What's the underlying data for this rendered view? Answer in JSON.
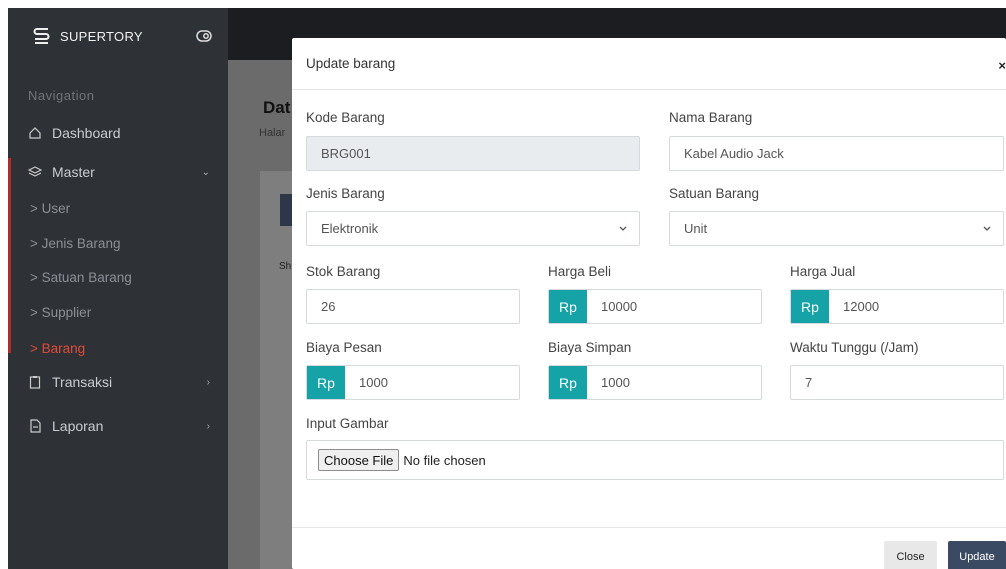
{
  "sidebar": {
    "brand": "SUPERTORY",
    "nav_title": "Navigation",
    "dashboard": "Dashboard",
    "master": "Master",
    "master_items": [
      "User",
      "Jenis Barang",
      "Satuan Barang",
      "Supplier",
      "Barang"
    ],
    "master_item_prefix": ">",
    "transaksi": "Transaksi",
    "laporan": "Laporan"
  },
  "page": {
    "heading": "Dat",
    "sub": "Halar",
    "sh": "Sh"
  },
  "modal": {
    "title": "Update barang",
    "close_x": "×",
    "fields": {
      "kode_label": "Kode Barang",
      "kode_value": "BRG001",
      "nama_label": "Nama Barang",
      "nama_value": "Kabel Audio Jack",
      "jenis_label": "Jenis Barang",
      "jenis_value": "Elektronik",
      "satuan_label": "Satuan Barang",
      "satuan_value": "Unit",
      "stok_label": "Stok Barang",
      "stok_value": "26",
      "harga_beli_label": "Harga Beli",
      "harga_beli_value": "10000",
      "harga_jual_label": "Harga Jual",
      "harga_jual_value": "12000",
      "biaya_pesan_label": "Biaya Pesan",
      "biaya_pesan_value": "1000",
      "biaya_simpan_label": "Biaya Simpan",
      "biaya_simpan_value": "1000",
      "waktu_label": "Waktu Tunggu (/Jam)",
      "waktu_value": "7",
      "gambar_label": "Input Gambar",
      "currency_prefix": "Rp",
      "choose_file": "Choose File",
      "no_file": "No file chosen"
    },
    "buttons": {
      "close": "Close",
      "update": "Update"
    }
  },
  "colors": {
    "accent": "#15a3a8",
    "update_button": "#3b4a63",
    "active_nav": "#e04b3a",
    "sidebar": "#2e3135"
  }
}
